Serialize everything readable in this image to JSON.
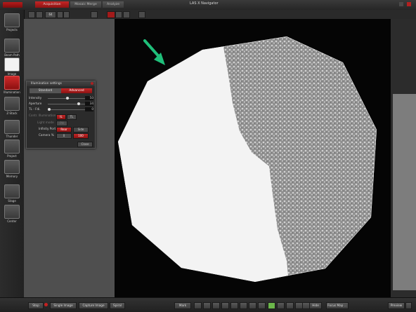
{
  "app": {
    "title": "LAS X Navigator",
    "tabs": [
      {
        "label": "Acquisition",
        "active": true
      },
      {
        "label": "Mosaic Merge",
        "active": false
      },
      {
        "label": "Analyze",
        "active": false
      }
    ]
  },
  "toolbar": {
    "zoom_value": "64"
  },
  "sidebar": {
    "items": [
      {
        "label": "Projects",
        "icon": "projects-icon"
      },
      {
        "label": "Beam Path",
        "icon": "beam-path-icon"
      },
      {
        "label": "Image",
        "icon": "camera-icon"
      },
      {
        "label": "Illumination",
        "icon": "lightbulb-icon",
        "active": true
      },
      {
        "label": "Z-Stack",
        "icon": "layers-icon"
      },
      {
        "label": "Thunder",
        "icon": "thunder-icon"
      },
      {
        "label": "Project",
        "icon": "project-icon"
      },
      {
        "label": "Memory",
        "icon": "chip-icon"
      },
      {
        "label": "Stage",
        "icon": "stage-icon"
      },
      {
        "label": "Center",
        "icon": "center-icon"
      }
    ]
  },
  "illumination_dialog": {
    "title": "Illumination settings",
    "mode_standard": "Standard",
    "mode_advanced": "Advanced",
    "intensity_label": "Intensity",
    "intensity_value": "50",
    "aperture_label": "Aperture",
    "aperture_value": "34",
    "tl_fieldmax_label": "TL - Fdi.",
    "tl_fieldmax_value": "0",
    "contr_label": "Contr. Illumination",
    "contr_btn1": "IL",
    "contr_btn2": "TL",
    "light_mode_label": "Light mode",
    "light_mode_value": "PH",
    "infinity_port_label": "Infinity Port",
    "infinity_rear": "Rear",
    "infinity_side": "Side",
    "camera_label": "Camera %",
    "camera_left": "0",
    "camera_right": "100",
    "close_label": "Close"
  },
  "bottombar": {
    "stop": "Stop",
    "single_image": "Single Image",
    "capture_image": "Capture Image",
    "spiral": "Spiral",
    "mark": "Mark",
    "hide": "Hide",
    "focus_map": "Focus Map ...",
    "preview": "Preview"
  },
  "colors": {
    "accent_red": "#c42626",
    "annotation_arrow": "#1fbf7a"
  }
}
